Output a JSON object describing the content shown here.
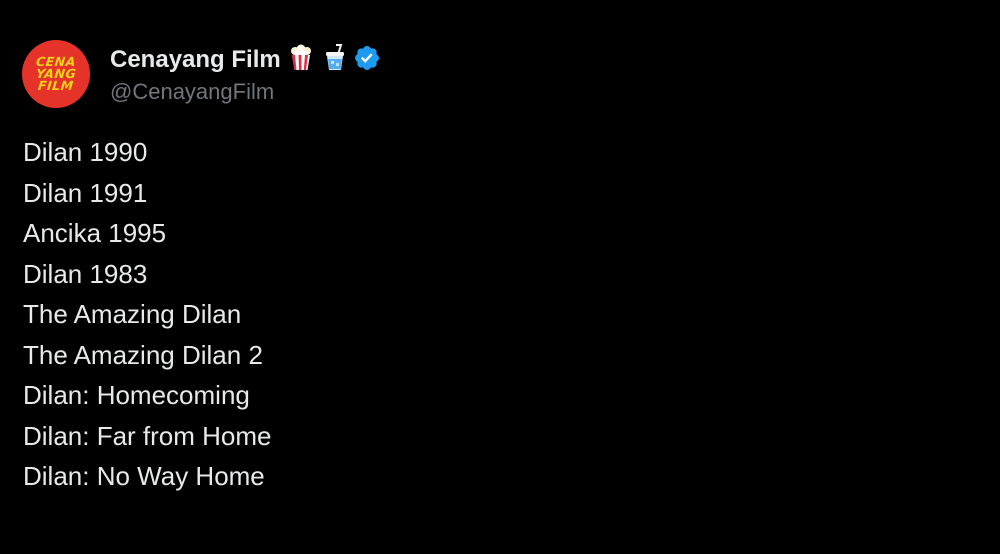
{
  "post": {
    "author": {
      "avatar_lines": [
        "CENA",
        "YANG",
        "FILM"
      ],
      "display_name": "Cenayang Film",
      "name_emojis": [
        "popcorn-icon",
        "soft-drink-cup-icon"
      ],
      "verified_badge": "verified-badge-icon",
      "handle": "@CenayangFilm"
    },
    "text_lines": [
      "Dilan 1990",
      "Dilan 1991",
      "Ancika 1995",
      "Dilan 1983",
      "The Amazing Dilan",
      "The Amazing Dilan 2",
      "Dilan: Homecoming",
      "Dilan: Far from Home",
      "Dilan: No Way Home"
    ]
  },
  "colors": {
    "background": "#000000",
    "primary_text": "#e7e9ea",
    "secondary_text": "#71767b",
    "verified_blue": "#1d9bf0",
    "avatar_red": "#e5332a",
    "avatar_text_yellow": "#f6d21b"
  }
}
